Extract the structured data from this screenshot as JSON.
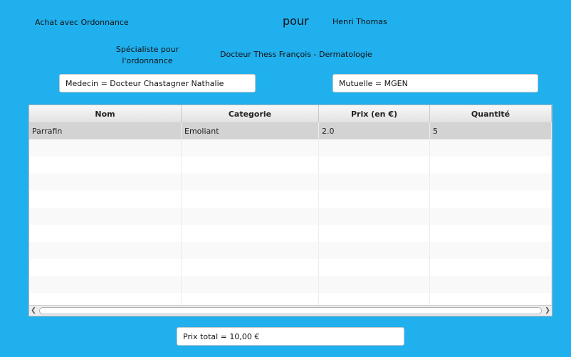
{
  "header": {
    "purchase_label": "Achat avec Ordonnance",
    "for_label": "pour",
    "patient_name": "Henri Thomas",
    "specialist_label_line1": "Spécialiste pour",
    "specialist_label_line2": "l'ordonnance",
    "specialist_value": "Docteur Thess François - Dermatologie"
  },
  "fields": {
    "doctor": "Medecin = Docteur Chastagner Nathalie",
    "insurance": "Mutuelle = MGEN"
  },
  "table": {
    "columns": [
      "Nom",
      "Categorie",
      "Prix (en €)",
      "Quantité"
    ],
    "rows": [
      [
        "Parrafin",
        "Emoliant",
        "2.0",
        "5"
      ]
    ]
  },
  "total": "Prix total = 10,00 €",
  "colors": {
    "background": "#20b0ee",
    "selected_row": "#d3d3d3"
  }
}
